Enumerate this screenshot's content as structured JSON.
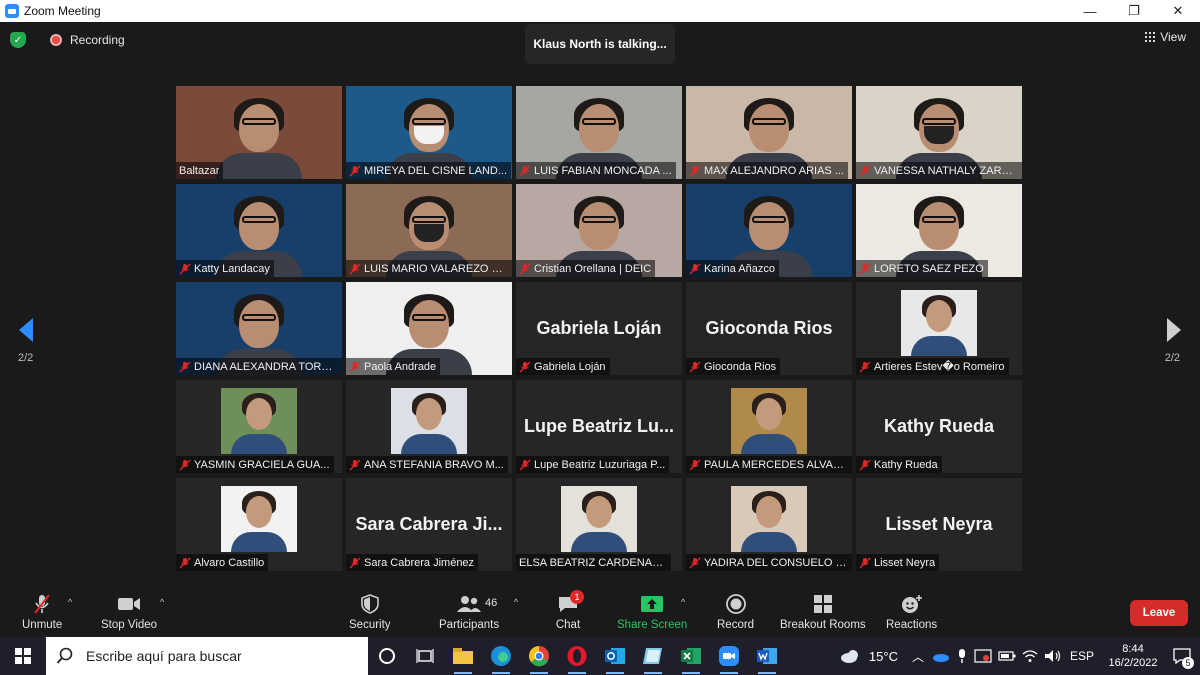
{
  "window": {
    "title": "Zoom Meeting",
    "minimize": "—",
    "maximize": "❐",
    "close": "✕"
  },
  "status": {
    "recording_label": "Recording",
    "talking": "Klaus North is talking...",
    "view_label": "View",
    "page_left": "2/2",
    "page_right": "2/2"
  },
  "colors": {
    "accent": "#2d8cff",
    "recording": "#e94a4a",
    "secure": "#23a84f",
    "leave": "#d62b2b",
    "share": "#27c463",
    "muted": "#e02828"
  },
  "participants": [
    {
      "name": "Baltazar",
      "type": "video",
      "muted": false,
      "bg": "#7a4a3a"
    },
    {
      "name": "MIREYA DEL CISNE LAND...",
      "type": "video",
      "muted": true,
      "bg": "#1d5a8a",
      "mask": "white"
    },
    {
      "name": "LUIS FABIAN MONCADA ...",
      "type": "video",
      "muted": true,
      "bg": "#a7a7a2"
    },
    {
      "name": "MAX ALEJANDRO ARIAS ...",
      "type": "video",
      "muted": true,
      "bg": "#c9b8a8"
    },
    {
      "name": "VANESSA NATHALY ZARA...",
      "type": "video",
      "muted": true,
      "bg": "#d9d3c8",
      "mask": "dark"
    },
    {
      "name": "Katty Landacay",
      "type": "video",
      "muted": true,
      "bg": "#173f6a"
    },
    {
      "name": "LUIS MARIO VALAREZO C...",
      "type": "video",
      "muted": true,
      "bg": "#8b6b55",
      "mask": "dark"
    },
    {
      "name": "Cristian Orellana | DEIC",
      "type": "video",
      "muted": true,
      "bg": "#b7a8a4"
    },
    {
      "name": "Karina Añazco",
      "type": "video",
      "muted": true,
      "bg": "#173f6a"
    },
    {
      "name": "LORETO SAEZ PEZO",
      "type": "video",
      "muted": true,
      "bg": "#ece8e2"
    },
    {
      "name": "DIANA ALEXANDRA TORR...",
      "type": "video",
      "muted": true,
      "bg": "#173f6a"
    },
    {
      "name": "Paola Andrade",
      "type": "video",
      "muted": true,
      "bg": "#efefef"
    },
    {
      "name": "Gabriela Loján",
      "type": "name",
      "big": "Gabriela Loján",
      "muted": true
    },
    {
      "name": "Gioconda Rios",
      "type": "name",
      "big": "Gioconda Rios",
      "muted": true
    },
    {
      "name": "Artieres Estev�o Romeiro",
      "type": "photo",
      "muted": true,
      "pbg": "#e8e8e8"
    },
    {
      "name": "YASMIN GRACIELA GUA...",
      "type": "photo",
      "muted": true,
      "pbg": "#6f8f5a"
    },
    {
      "name": "ANA STEFANIA BRAVO M...",
      "type": "photo",
      "muted": true,
      "pbg": "#dcdfe6"
    },
    {
      "name": "Lupe Beatriz Luzuriaga P...",
      "type": "name",
      "big": "Lupe Beatriz Lu...",
      "muted": true
    },
    {
      "name": "PAULA MERCEDES ALVAR...",
      "type": "photo",
      "muted": true,
      "pbg": "#b08a4a"
    },
    {
      "name": "Kathy Rueda",
      "type": "name",
      "big": "Kathy Rueda",
      "muted": true
    },
    {
      "name": "Alvaro Castillo",
      "type": "photo",
      "muted": true,
      "pbg": "#f2f2f2"
    },
    {
      "name": "Sara Cabrera Jiménez",
      "type": "name",
      "big": "Sara Cabrera Ji...",
      "muted": true
    },
    {
      "name": "ELSA BEATRIZ CARDENAS SE...",
      "type": "photo",
      "muted": false,
      "pbg": "#e4e0da"
    },
    {
      "name": "YADIRA DEL CONSUELO S...",
      "type": "photo",
      "muted": true,
      "pbg": "#d8c9b8"
    },
    {
      "name": "Lisset Neyra",
      "type": "name",
      "big": "Lisset Neyra",
      "muted": true
    }
  ],
  "toolbar": {
    "unmute": "Unmute",
    "stop_video": "Stop Video",
    "security": "Security",
    "participants": "Participants",
    "participants_count": "46",
    "chat": "Chat",
    "chat_badge": "1",
    "share_screen": "Share Screen",
    "record": "Record",
    "breakout_rooms": "Breakout Rooms",
    "reactions": "Reactions",
    "leave": "Leave"
  },
  "taskbar": {
    "search_placeholder": "Escribe aquí para buscar",
    "temperature": "15°C",
    "language": "ESP",
    "time": "8:44",
    "date": "16/2/2022",
    "notifications": "5"
  }
}
